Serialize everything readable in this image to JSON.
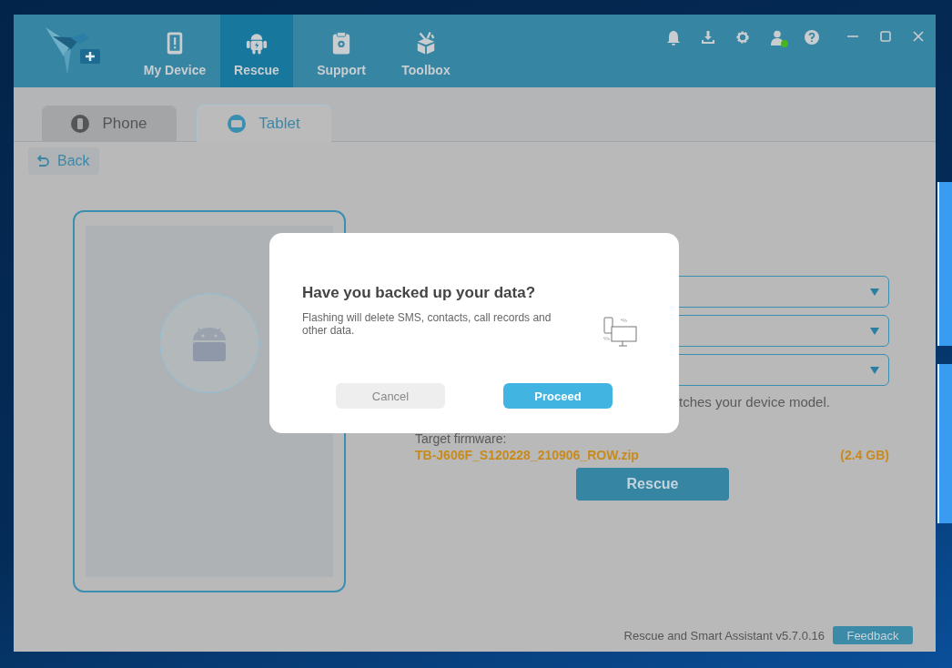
{
  "header": {
    "nav": [
      {
        "label": "My Device",
        "kind": "device",
        "selected": false
      },
      {
        "label": "Rescue",
        "kind": "rescue",
        "selected": true
      },
      {
        "label": "Support",
        "kind": "support",
        "selected": false
      },
      {
        "label": "Toolbox",
        "kind": "toolbox",
        "selected": false
      }
    ],
    "account_online": true
  },
  "device_tabs": [
    {
      "label": "Phone",
      "kind": "phone",
      "selected": false
    },
    {
      "label": "Tablet",
      "kind": "tablet",
      "selected": true
    }
  ],
  "back": "Back",
  "hint": "tches your device model.",
  "firmware": {
    "label": "Target firmware:",
    "file": "TB-J606F_S120228_210906_ROW.zip",
    "size": "(2.4 GB)"
  },
  "rescue_button": "Rescue",
  "footer": {
    "version": "Rescue and Smart Assistant v5.7.0.16",
    "feedback": "Feedback"
  },
  "dialog": {
    "title": "Have you backed up your data?",
    "message": "Flashing will delete SMS, contacts, call records and other data.",
    "buttons": [
      {
        "label": "Cancel",
        "kind": "secondary"
      },
      {
        "label": "Proceed",
        "kind": "primary"
      }
    ]
  }
}
